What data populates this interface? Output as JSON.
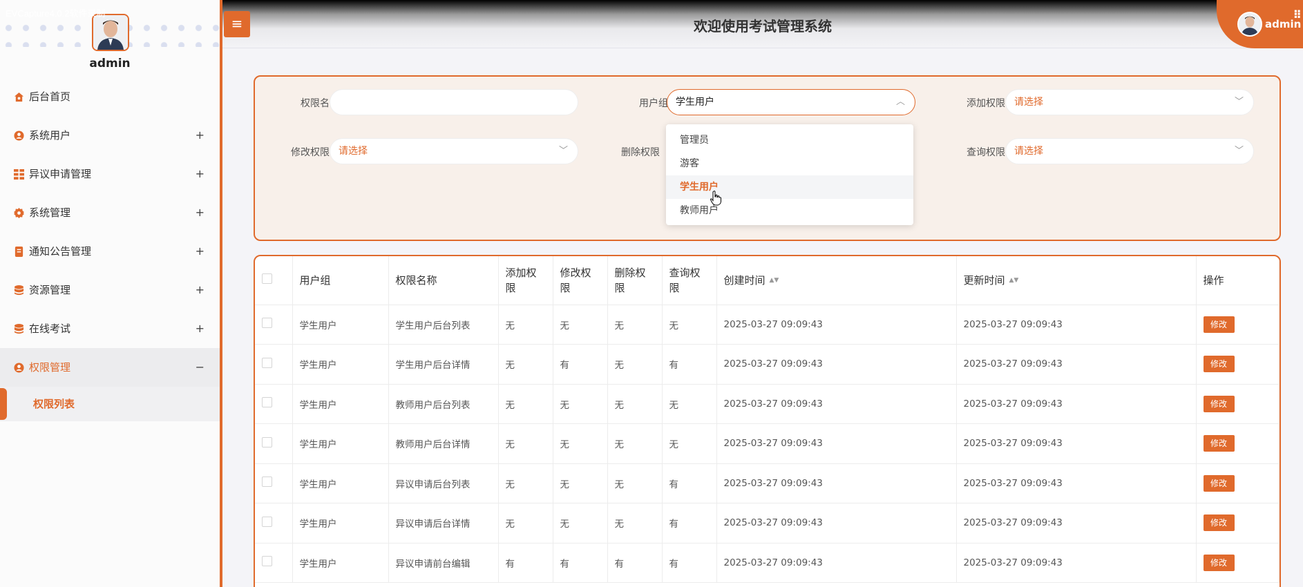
{
  "watermark": "EVCapture4.0.2软件录制",
  "header": {
    "title": "欢迎使用考试管理系统",
    "user_name": "admin",
    "chevron": "⌄",
    "grid_icon": "⠿"
  },
  "sidebar": {
    "user_name": "admin",
    "items": [
      {
        "label": "后台首页",
        "icon": "home-icon",
        "expand": ""
      },
      {
        "label": "系统用户",
        "icon": "user-icon",
        "expand": "+"
      },
      {
        "label": "异议申请管理",
        "icon": "grid-icon",
        "expand": "+"
      },
      {
        "label": "系统管理",
        "icon": "gear-icon",
        "expand": "+"
      },
      {
        "label": "通知公告管理",
        "icon": "document-icon",
        "expand": "+"
      },
      {
        "label": "资源管理",
        "icon": "database-icon",
        "expand": "+"
      },
      {
        "label": "在线考试",
        "icon": "database-icon",
        "expand": "+"
      },
      {
        "label": "权限管理",
        "icon": "user-icon",
        "expand": "−"
      }
    ],
    "sub_item": "权限列表"
  },
  "search": {
    "fields": [
      {
        "label": "权限名",
        "value": "",
        "placeholder": ""
      },
      {
        "label": "用户组",
        "value": "学生用户"
      },
      {
        "label": "添加权限",
        "value": "请选择"
      },
      {
        "label": "修改权限",
        "value": "请选择"
      },
      {
        "label": "删除权限",
        "value": ""
      },
      {
        "label": "查询权限",
        "value": "请选择"
      }
    ],
    "dropdown_options": [
      "管理员",
      "游客",
      "学生用户",
      "教师用户"
    ],
    "dropdown_selected": "学生用户"
  },
  "table": {
    "columns": [
      "用户组",
      "权限名称",
      "添加权限",
      "修改权限",
      "删除权限",
      "查询权限",
      "创建时间",
      "更新时间",
      "操作"
    ],
    "sort_icon": "▲▼",
    "edit_label": "修改",
    "rows": [
      [
        "学生用户",
        "学生用户后台列表",
        "无",
        "无",
        "无",
        "无",
        "2025-03-27 09:09:43",
        "2025-03-27 09:09:43"
      ],
      [
        "学生用户",
        "学生用户后台详情",
        "无",
        "有",
        "无",
        "有",
        "2025-03-27 09:09:43",
        "2025-03-27 09:09:43"
      ],
      [
        "学生用户",
        "教师用户后台列表",
        "无",
        "无",
        "无",
        "无",
        "2025-03-27 09:09:43",
        "2025-03-27 09:09:43"
      ],
      [
        "学生用户",
        "教师用户后台详情",
        "无",
        "无",
        "无",
        "无",
        "2025-03-27 09:09:43",
        "2025-03-27 09:09:43"
      ],
      [
        "学生用户",
        "异议申请后台列表",
        "无",
        "无",
        "无",
        "有",
        "2025-03-27 09:09:43",
        "2025-03-27 09:09:43"
      ],
      [
        "学生用户",
        "异议申请后台详情",
        "无",
        "无",
        "无",
        "有",
        "2025-03-27 09:09:43",
        "2025-03-27 09:09:43"
      ],
      [
        "学生用户",
        "异议申请前台编辑",
        "有",
        "有",
        "有",
        "有",
        "2025-03-27 09:09:43",
        "2025-03-27 09:09:43"
      ]
    ]
  },
  "colors": {
    "accent": "#e06a2c",
    "panel_bg": "#f8f0ea"
  }
}
